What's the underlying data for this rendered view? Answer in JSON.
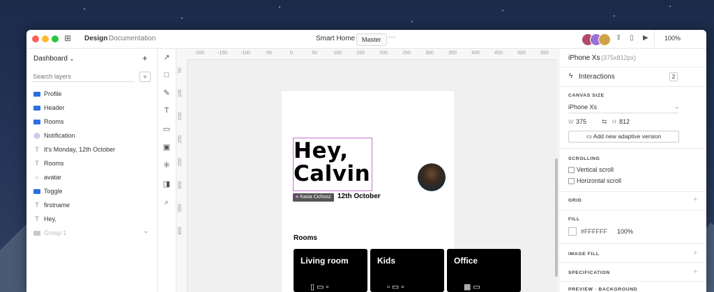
{
  "window": {
    "tabs": {
      "design": "Design",
      "documentation": "Documentation"
    },
    "project_title": "Smart Home",
    "branch": "Master",
    "more": "···",
    "zoom": "100%"
  },
  "layers_panel": {
    "title": "Dashboard",
    "add": "+",
    "search_placeholder": "Search layers",
    "items": [
      {
        "label": "Profile",
        "icon": "folder-icon"
      },
      {
        "label": "Header",
        "icon": "folder-icon"
      },
      {
        "label": "Rooms",
        "icon": "folder-icon"
      },
      {
        "label": "Notification",
        "icon": "component-icon"
      },
      {
        "label": "It's Monday, 12th October",
        "icon": "text-icon"
      },
      {
        "label": "Rooms",
        "icon": "text-icon"
      },
      {
        "label": "avatar",
        "icon": "ellipse-icon"
      },
      {
        "label": "Toggle",
        "icon": "folder-icon"
      },
      {
        "label": "firstname",
        "icon": "text-icon"
      },
      {
        "label": "Hey,",
        "icon": "text-icon"
      },
      {
        "label": "Group 1",
        "icon": "folder-icon"
      }
    ]
  },
  "ruler": {
    "top": [
      "-200",
      "-150",
      "-100",
      "-50",
      "0",
      "50",
      "100",
      "150",
      "200",
      "250",
      "300",
      "350",
      "400",
      "450",
      "500",
      "550"
    ],
    "left": [
      "50",
      "100",
      "150",
      "200",
      "250",
      "300",
      "350",
      "400"
    ]
  },
  "artboard": {
    "heading_line1": "Hey,",
    "heading_line2": "Calvin",
    "collaborator": "Kasia Cichosz",
    "date_visible": "12th October",
    "rooms_title": "Rooms",
    "cards": [
      "Living room",
      "Kids",
      "Office"
    ]
  },
  "inspector": {
    "device": "iPhone Xs",
    "device_size": "(375x812px)",
    "interactions_label": "Interactions",
    "interactions_count": "2",
    "canvas_size_label": "CANVAS SIZE",
    "canvas_device": "iPhone Xs",
    "w_label": "W",
    "w_value": "375",
    "h_label": "H",
    "h_value": "812",
    "adaptive_btn": "Add new adaptive version",
    "scrolling_label": "SCROLLING",
    "vertical_scroll": "Vertical scroll",
    "horizontal_scroll": "Horizontal scroll",
    "grid_label": "GRID",
    "fill_label": "FILL",
    "fill_hex": "#FFFFFF",
    "fill_opacity": "100%",
    "image_fill_label": "IMAGE FILL",
    "specification_label": "SPECIFICATION",
    "preview_label": "PREVIEW · BACKGROUND"
  },
  "colors": {
    "accent": "#c76fd0",
    "folder": "#2b6fe0",
    "close": "#fe5f57",
    "minimize": "#febc2e",
    "zoom": "#28c840"
  }
}
